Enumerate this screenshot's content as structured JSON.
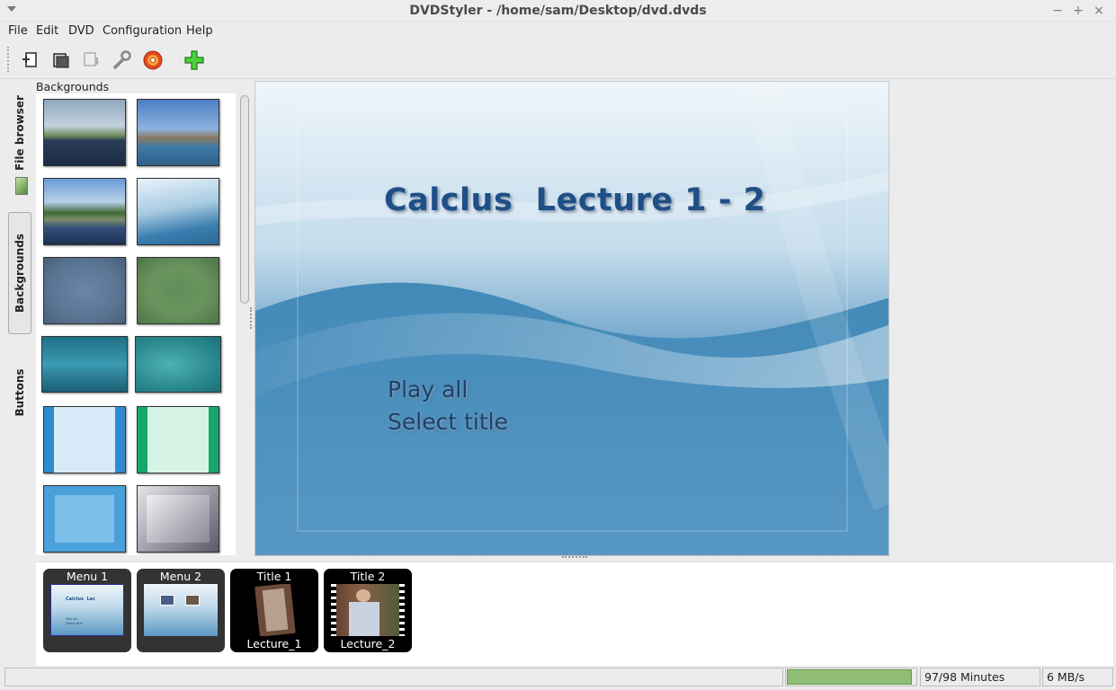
{
  "window": {
    "title": "DVDStyler - /home/sam/Desktop/dvd.dvds",
    "controls": {
      "minimize": "−",
      "maximize": "+",
      "close": "×"
    }
  },
  "menubar": {
    "items": [
      "File",
      "Edit",
      "DVD",
      "Configuration",
      "Help"
    ]
  },
  "toolbar": {
    "buttons": [
      {
        "name": "new-project",
        "icon": "new-document-icon"
      },
      {
        "name": "open-project",
        "icon": "open-folder-icon"
      },
      {
        "name": "save-project",
        "icon": "save-icon",
        "disabled": true
      },
      {
        "name": "settings",
        "icon": "wrench-icon"
      },
      {
        "name": "burn-dvd",
        "icon": "burn-disc-icon"
      },
      {
        "name": "add",
        "icon": "green-plus-icon"
      }
    ]
  },
  "side_tabs": [
    "File browser",
    "Backgrounds",
    "Buttons"
  ],
  "panel": {
    "title": "Backgrounds"
  },
  "menu_canvas": {
    "title": "Calclus  Lecture 1 - 2",
    "buttons": [
      "Play all",
      "Select title"
    ]
  },
  "titleset": {
    "items": [
      {
        "top_label": "Menu 1",
        "bottom_label": ""
      },
      {
        "top_label": "Menu 2",
        "bottom_label": ""
      },
      {
        "top_label": "Title 1",
        "bottom_label": "Lecture_1"
      },
      {
        "top_label": "Title 2",
        "bottom_label": "Lecture_2"
      }
    ],
    "menu1_thumb_text": [
      "Calclus  Lec",
      "Play all",
      "Select title"
    ]
  },
  "statusbar": {
    "message": "",
    "progress_fraction": 0.97,
    "minutes": "97/98 Minutes",
    "rate": "6 MB/s"
  },
  "colors": {
    "accent_blue": "#1f4f86",
    "progress_green": "#8fbd74"
  }
}
